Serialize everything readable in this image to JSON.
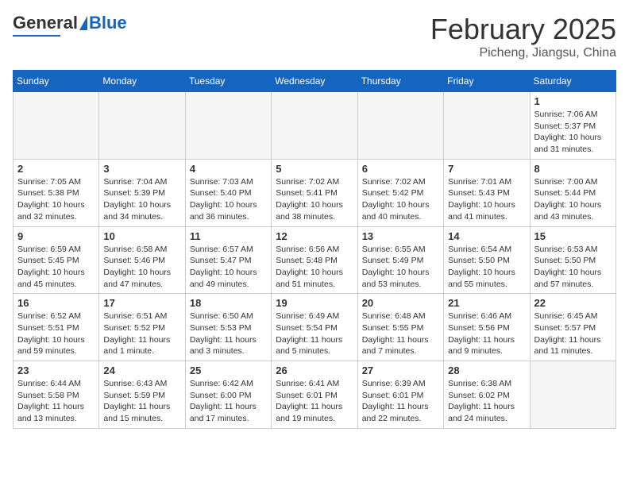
{
  "header": {
    "logo_general": "General",
    "logo_blue": "Blue",
    "month": "February 2025",
    "location": "Picheng, Jiangsu, China"
  },
  "days_of_week": [
    "Sunday",
    "Monday",
    "Tuesday",
    "Wednesday",
    "Thursday",
    "Friday",
    "Saturday"
  ],
  "weeks": [
    [
      {
        "day": "",
        "info": ""
      },
      {
        "day": "",
        "info": ""
      },
      {
        "day": "",
        "info": ""
      },
      {
        "day": "",
        "info": ""
      },
      {
        "day": "",
        "info": ""
      },
      {
        "day": "",
        "info": ""
      },
      {
        "day": "1",
        "info": "Sunrise: 7:06 AM\nSunset: 5:37 PM\nDaylight: 10 hours\nand 31 minutes."
      }
    ],
    [
      {
        "day": "2",
        "info": "Sunrise: 7:05 AM\nSunset: 5:38 PM\nDaylight: 10 hours\nand 32 minutes."
      },
      {
        "day": "3",
        "info": "Sunrise: 7:04 AM\nSunset: 5:39 PM\nDaylight: 10 hours\nand 34 minutes."
      },
      {
        "day": "4",
        "info": "Sunrise: 7:03 AM\nSunset: 5:40 PM\nDaylight: 10 hours\nand 36 minutes."
      },
      {
        "day": "5",
        "info": "Sunrise: 7:02 AM\nSunset: 5:41 PM\nDaylight: 10 hours\nand 38 minutes."
      },
      {
        "day": "6",
        "info": "Sunrise: 7:02 AM\nSunset: 5:42 PM\nDaylight: 10 hours\nand 40 minutes."
      },
      {
        "day": "7",
        "info": "Sunrise: 7:01 AM\nSunset: 5:43 PM\nDaylight: 10 hours\nand 41 minutes."
      },
      {
        "day": "8",
        "info": "Sunrise: 7:00 AM\nSunset: 5:44 PM\nDaylight: 10 hours\nand 43 minutes."
      }
    ],
    [
      {
        "day": "9",
        "info": "Sunrise: 6:59 AM\nSunset: 5:45 PM\nDaylight: 10 hours\nand 45 minutes."
      },
      {
        "day": "10",
        "info": "Sunrise: 6:58 AM\nSunset: 5:46 PM\nDaylight: 10 hours\nand 47 minutes."
      },
      {
        "day": "11",
        "info": "Sunrise: 6:57 AM\nSunset: 5:47 PM\nDaylight: 10 hours\nand 49 minutes."
      },
      {
        "day": "12",
        "info": "Sunrise: 6:56 AM\nSunset: 5:48 PM\nDaylight: 10 hours\nand 51 minutes."
      },
      {
        "day": "13",
        "info": "Sunrise: 6:55 AM\nSunset: 5:49 PM\nDaylight: 10 hours\nand 53 minutes."
      },
      {
        "day": "14",
        "info": "Sunrise: 6:54 AM\nSunset: 5:50 PM\nDaylight: 10 hours\nand 55 minutes."
      },
      {
        "day": "15",
        "info": "Sunrise: 6:53 AM\nSunset: 5:50 PM\nDaylight: 10 hours\nand 57 minutes."
      }
    ],
    [
      {
        "day": "16",
        "info": "Sunrise: 6:52 AM\nSunset: 5:51 PM\nDaylight: 10 hours\nand 59 minutes."
      },
      {
        "day": "17",
        "info": "Sunrise: 6:51 AM\nSunset: 5:52 PM\nDaylight: 11 hours\nand 1 minute."
      },
      {
        "day": "18",
        "info": "Sunrise: 6:50 AM\nSunset: 5:53 PM\nDaylight: 11 hours\nand 3 minutes."
      },
      {
        "day": "19",
        "info": "Sunrise: 6:49 AM\nSunset: 5:54 PM\nDaylight: 11 hours\nand 5 minutes."
      },
      {
        "day": "20",
        "info": "Sunrise: 6:48 AM\nSunset: 5:55 PM\nDaylight: 11 hours\nand 7 minutes."
      },
      {
        "day": "21",
        "info": "Sunrise: 6:46 AM\nSunset: 5:56 PM\nDaylight: 11 hours\nand 9 minutes."
      },
      {
        "day": "22",
        "info": "Sunrise: 6:45 AM\nSunset: 5:57 PM\nDaylight: 11 hours\nand 11 minutes."
      }
    ],
    [
      {
        "day": "23",
        "info": "Sunrise: 6:44 AM\nSunset: 5:58 PM\nDaylight: 11 hours\nand 13 minutes."
      },
      {
        "day": "24",
        "info": "Sunrise: 6:43 AM\nSunset: 5:59 PM\nDaylight: 11 hours\nand 15 minutes."
      },
      {
        "day": "25",
        "info": "Sunrise: 6:42 AM\nSunset: 6:00 PM\nDaylight: 11 hours\nand 17 minutes."
      },
      {
        "day": "26",
        "info": "Sunrise: 6:41 AM\nSunset: 6:01 PM\nDaylight: 11 hours\nand 19 minutes."
      },
      {
        "day": "27",
        "info": "Sunrise: 6:39 AM\nSunset: 6:01 PM\nDaylight: 11 hours\nand 22 minutes."
      },
      {
        "day": "28",
        "info": "Sunrise: 6:38 AM\nSunset: 6:02 PM\nDaylight: 11 hours\nand 24 minutes."
      },
      {
        "day": "",
        "info": ""
      }
    ]
  ]
}
